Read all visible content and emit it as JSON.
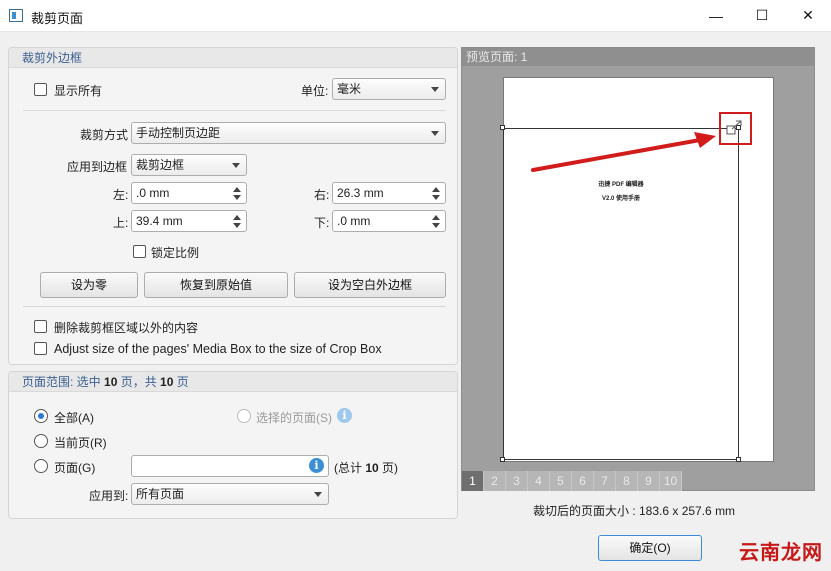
{
  "window": {
    "title": "裁剪页面",
    "minimize_glyph": "—",
    "maximize_glyph": "☐",
    "close_glyph": "✕"
  },
  "crop_margins": {
    "section_title": "裁剪外边框",
    "show_all_label": "显示所有",
    "show_all_checked": false,
    "unit_label": "单位:",
    "unit_value": "毫米",
    "crop_method_label": "裁剪方式",
    "crop_method_value": "手动控制页边距",
    "apply_to_box_label": "应用到边框",
    "apply_to_box_value": "裁剪边框",
    "left_label": "左:",
    "left_value": ".0 mm",
    "right_label": "右:",
    "right_value": "26.3 mm",
    "top_label": "上:",
    "top_value": "39.4 mm",
    "bottom_label": "下:",
    "bottom_value": ".0 mm",
    "lock_ratio_label": "锁定比例",
    "lock_ratio_checked": false,
    "set_zero_button": "设为零",
    "restore_button": "恢复到原始值",
    "set_blank_button": "设为空白外边框",
    "delete_outside_label": "删除裁剪框区域以外的内容",
    "adjust_media_box_label": "Adjust size of the pages' Media Box to the size of Crop Box"
  },
  "page_range": {
    "section_title_prefix": "页面范围: 选中 ",
    "selected_count": "10",
    "section_title_mid": " 页，共 ",
    "total_count": "10",
    "section_title_suffix": " 页",
    "all_label": "全部(A)",
    "selected_pages_label": "选择的页面(S)",
    "current_label": "当前页(R)",
    "pages_label": "页面(G)",
    "pages_input_value": "",
    "total_prefix": "(总计 ",
    "total_value": "10",
    "total_suffix": " 页)",
    "apply_to_label": "应用到:",
    "apply_to_value": "所有页面",
    "selected_option": "all"
  },
  "preview": {
    "title": "预览页面: 1",
    "doc_line1": "迅捷 PDF 编辑器",
    "doc_line2": "V2.0 使用手册",
    "page_tabs": [
      "1",
      "2",
      "3",
      "4",
      "5",
      "6",
      "7",
      "8",
      "9",
      "10"
    ],
    "active_tab": "1",
    "cropped_size": "裁切后的页面大小 : 183.6 x 257.6 mm"
  },
  "footer": {
    "ok_button": "确定(O)"
  },
  "watermark": "云南龙网",
  "colors": {
    "section_title": "#3a5f8f",
    "highlight_box": "#d21c1c",
    "arrow": "#d21c1c",
    "radio_selected": "#2a7ad6"
  }
}
